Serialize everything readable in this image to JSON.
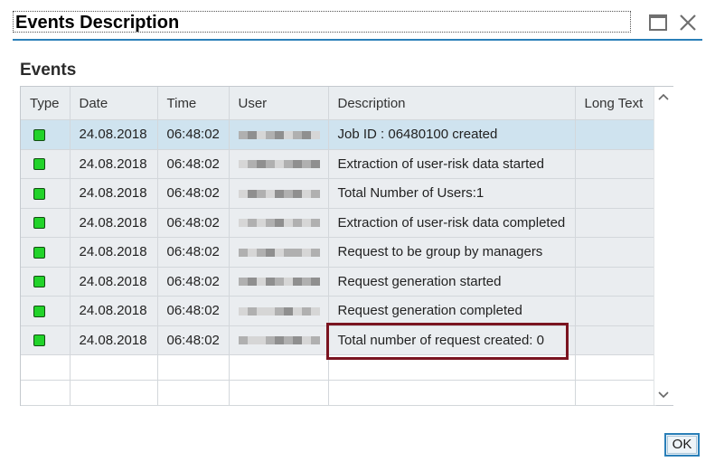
{
  "dialog": {
    "title": "Events Description"
  },
  "section": {
    "title": "Events"
  },
  "table": {
    "columns": [
      "Type",
      "Date",
      "Time",
      "User",
      "Description",
      "Long Text"
    ],
    "rows": [
      {
        "date": "24.08.2018",
        "time": "06:48:02",
        "description": "Job ID : 06480100 created",
        "long_text": ""
      },
      {
        "date": "24.08.2018",
        "time": "06:48:02",
        "description": "Extraction of user-risk data started",
        "long_text": ""
      },
      {
        "date": "24.08.2018",
        "time": "06:48:02",
        "description": "Total Number of Users:1",
        "long_text": ""
      },
      {
        "date": "24.08.2018",
        "time": "06:48:02",
        "description": "Extraction of user-risk data completed",
        "long_text": ""
      },
      {
        "date": "24.08.2018",
        "time": "06:48:02",
        "description": "Request to be group by managers",
        "long_text": ""
      },
      {
        "date": "24.08.2018",
        "time": "06:48:02",
        "description": "Request generation started",
        "long_text": ""
      },
      {
        "date": "24.08.2018",
        "time": "06:48:02",
        "description": "Request generation completed",
        "long_text": ""
      },
      {
        "date": "24.08.2018",
        "time": "06:48:02",
        "description": "Total number of request created: 0",
        "long_text": ""
      }
    ],
    "selected_row": 0,
    "status_color": "#22d32a"
  },
  "buttons": {
    "ok": "OK"
  },
  "colors": {
    "accent": "#2a7fb8",
    "highlight_border": "#7a1420",
    "selected_row": "#cfe3ef"
  }
}
